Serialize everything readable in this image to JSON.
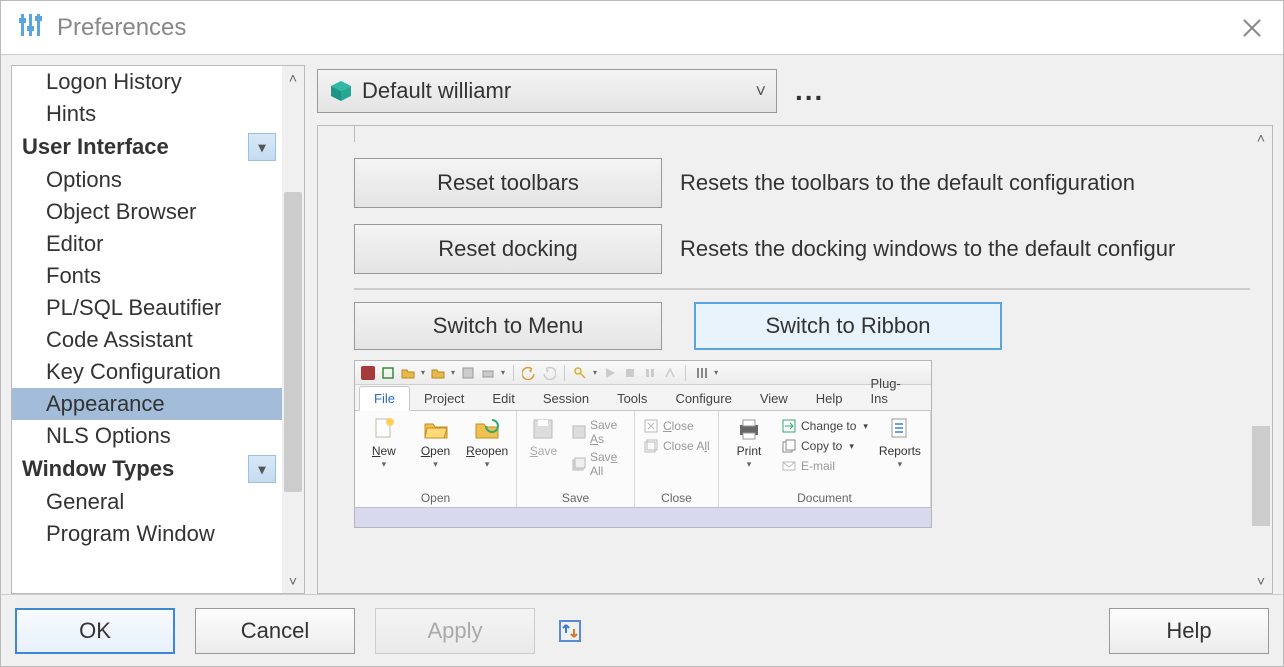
{
  "window": {
    "title": "Preferences"
  },
  "profile": {
    "label": "Default williamr"
  },
  "sidebar": {
    "top_items": [
      "Logon History",
      "Hints"
    ],
    "cat_ui": "User Interface",
    "ui_items": [
      "Options",
      "Object Browser",
      "Editor",
      "Fonts",
      "PL/SQL Beautifier",
      "Code Assistant",
      "Key Configuration",
      "Appearance",
      "NLS Options"
    ],
    "cat_wt": "Window Types",
    "wt_items": [
      "General",
      "Program Window"
    ],
    "selected": "Appearance"
  },
  "panel": {
    "reset_toolbars_btn": "Reset toolbars",
    "reset_toolbars_desc": "Resets the toolbars to the default configuration",
    "reset_docking_btn": "Reset docking",
    "reset_docking_desc": "Resets the docking windows to the default configur",
    "switch_menu_btn": "Switch to Menu",
    "switch_ribbon_btn": "Switch to Ribbon"
  },
  "ribbon": {
    "tabs": [
      "File",
      "Project",
      "Edit",
      "Session",
      "Tools",
      "Configure",
      "View",
      "Help",
      "Plug-Ins"
    ],
    "active_tab": "File",
    "group_open": "Open",
    "group_save": "Save",
    "group_close": "Close",
    "group_document": "Document",
    "btn_new": "New",
    "btn_open": "Open",
    "btn_reopen": "Reopen",
    "btn_save": "Save",
    "btn_save_as": "Save As",
    "btn_save_all": "Save All",
    "btn_close": "Close",
    "btn_close_all": "Close All",
    "btn_print": "Print",
    "btn_change_to": "Change to",
    "btn_copy_to": "Copy to",
    "btn_email": "E-mail",
    "btn_reports": "Reports"
  },
  "footer": {
    "ok": "OK",
    "cancel": "Cancel",
    "apply": "Apply",
    "help": "Help"
  }
}
